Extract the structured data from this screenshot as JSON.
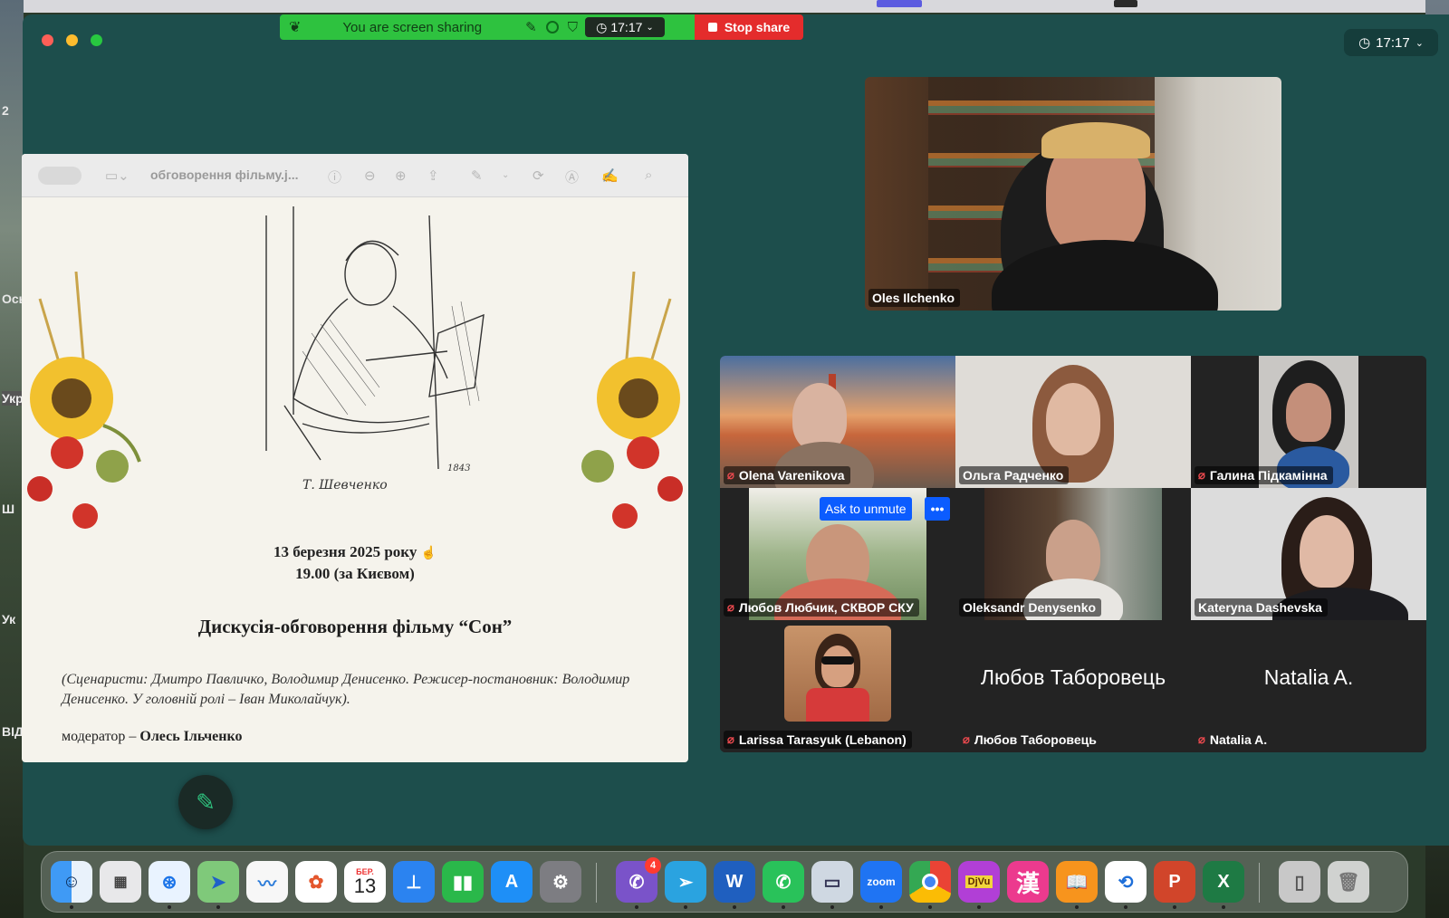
{
  "desktop": {
    "left_labels": [
      "2",
      "Ось",
      "Укр",
      "Ш",
      "Ук",
      "ВІД"
    ]
  },
  "window": {
    "clock": "17:17"
  },
  "share_bar": {
    "status_text": "You are screen sharing",
    "time": "17:17",
    "stop_label": "Stop share"
  },
  "preview": {
    "file_title": "обговорення фільму.j...",
    "signature": "Т. Шевченко",
    "year_mark": "1843",
    "date_line": "13 березня 2025 року",
    "time_line": "19.00 (за Києвом)",
    "title": "Дискусія-обговорення фільму “Сон”",
    "credits": "(Сценаристи: Дмитро Павличко, Володимир Денисенко. Режисер-постановник: Володимир Денисенко. У головній ролі – Іван Миколайчук).",
    "moderator_prefix": "модератор –",
    "moderator_name": "Олесь Ільченко"
  },
  "speaker": {
    "name": "Oles Ilchenko"
  },
  "participants": [
    {
      "name": "Olena Varenikova",
      "muted": true,
      "video": true,
      "bg": "bridge"
    },
    {
      "name": "Ольга Радченко",
      "muted": false,
      "video": true,
      "bg": "light"
    },
    {
      "name": "Галина Підкамінна",
      "muted": true,
      "video": true,
      "bg": "dark"
    },
    {
      "name": "Любов Любчик, СКВОР СКУ",
      "muted": true,
      "video": true,
      "bg": "window",
      "ask_unmute": "Ask to unmute",
      "more": "•••"
    },
    {
      "name": "Oleksandr Denysenko",
      "muted": false,
      "video": true,
      "bg": "room"
    },
    {
      "name": "Kateryna Dashevska",
      "muted": false,
      "video": true,
      "bg": "grey"
    },
    {
      "name": "Larissa Tarasyuk (Lebanon)",
      "muted": true,
      "video": true,
      "bg": "sand"
    },
    {
      "name": "Любов Таборовець",
      "muted": true,
      "video": false,
      "display": "Любов Таборовець"
    },
    {
      "name": "Natalia A.",
      "muted": true,
      "video": false,
      "display": "Natalia A."
    }
  ],
  "dock": {
    "calendar_month": "БЕР.",
    "calendar_day": "13",
    "viber_badge": "4",
    "zoom_label": "zoom",
    "kanji": "漢",
    "djvu": "DjVu",
    "icons": [
      "finder-icon",
      "launchpad-icon",
      "safari-icon",
      "maps-icon",
      "freeform-icon",
      "photos-icon",
      "calendar-icon",
      "keynote-icon",
      "numbers-icon",
      "app-store-icon",
      "system-settings-icon",
      "viber-icon",
      "telegram-icon",
      "word-icon",
      "whatsapp-icon",
      "preview-icon",
      "zoom-icon",
      "chrome-icon",
      "djvu-icon",
      "kanji-icon",
      "books-icon",
      "sync-icon",
      "powerpoint-icon",
      "excel-icon",
      "downloads-icon",
      "trash-icon"
    ]
  }
}
